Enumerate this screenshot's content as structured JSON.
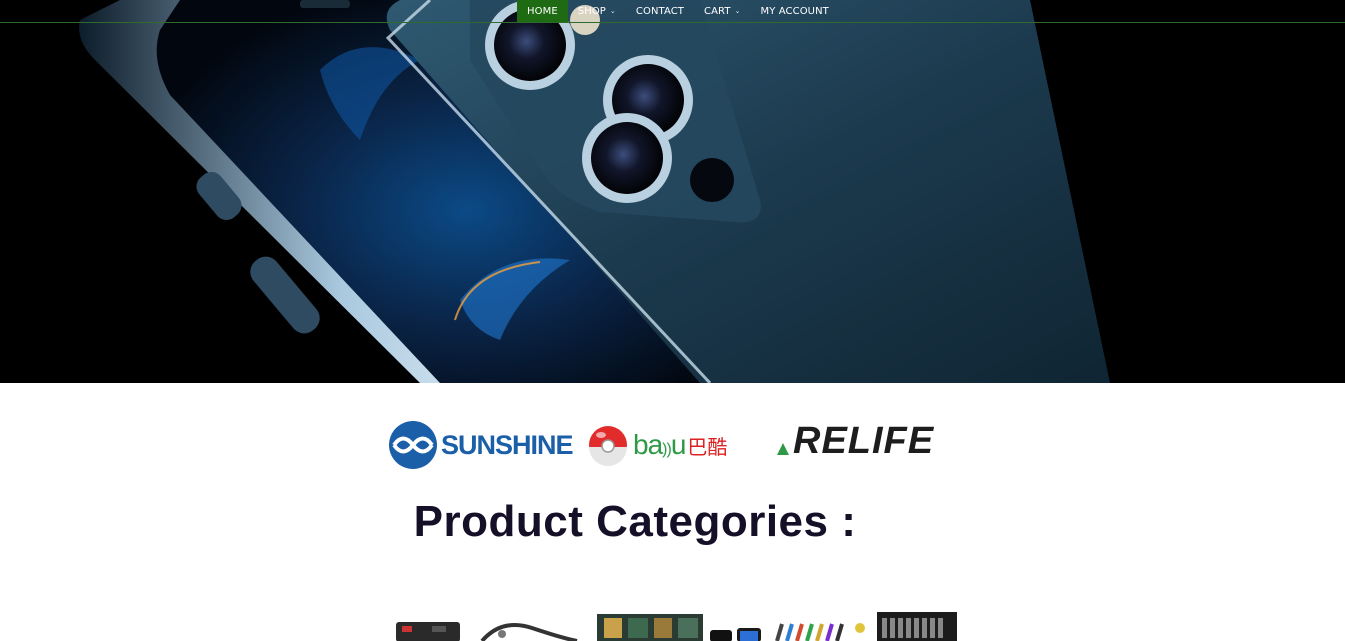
{
  "nav": {
    "items": [
      {
        "label": "HOME",
        "active": true,
        "dropdown": false
      },
      {
        "label": "SHOP",
        "active": false,
        "dropdown": true
      },
      {
        "label": "CONTACT",
        "active": false,
        "dropdown": false
      },
      {
        "label": "CART",
        "active": false,
        "dropdown": true
      },
      {
        "label": "MY ACCOUNT",
        "active": false,
        "dropdown": false
      }
    ],
    "chevron": "⌄"
  },
  "brands": {
    "sunshine": "SUNSHINE",
    "baku": "ba",
    "baku_tail": "u",
    "baku_cn": "巴酷",
    "relife": "RELIFE"
  },
  "section": {
    "title": "Product Categories :"
  },
  "colors": {
    "nav_active": "#1f6b13",
    "nav_divider": "#2f6b2f",
    "heading": "#150f28",
    "sunshine_blue": "#1b5fa9",
    "baku_green": "#2e9a47"
  },
  "icons": [
    "phone-hero-image",
    "sunshine-logo-icon",
    "baku-ball-icon",
    "relife-logo",
    "category-thumbnails"
  ]
}
